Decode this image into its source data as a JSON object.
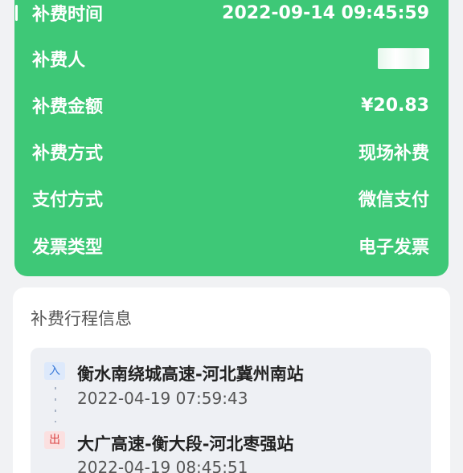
{
  "payment_summary": {
    "rows": [
      {
        "label": "补费时间",
        "value": "2022-09-14 09:45:59"
      },
      {
        "label": "补费人",
        "value": ""
      },
      {
        "label": "补费金额",
        "value": "¥20.83"
      },
      {
        "label": "补费方式",
        "value": "现场补费"
      },
      {
        "label": "支付方式",
        "value": "微信支付"
      },
      {
        "label": "发票类型",
        "value": "电子发票"
      }
    ]
  },
  "trip": {
    "title": "补费行程信息",
    "entry": {
      "badge": "入",
      "station": "衡水南绕城高速-河北冀州南站",
      "time": "2022-04-19 07:59:43"
    },
    "exit": {
      "badge": "出",
      "station": "大广高速-衡大段-河北枣强站",
      "time": "2022-04-19 08:45:51"
    }
  },
  "colors": {
    "card_green": "#3ec877",
    "entry_badge": "#3a7ad9",
    "exit_badge": "#d94343"
  }
}
